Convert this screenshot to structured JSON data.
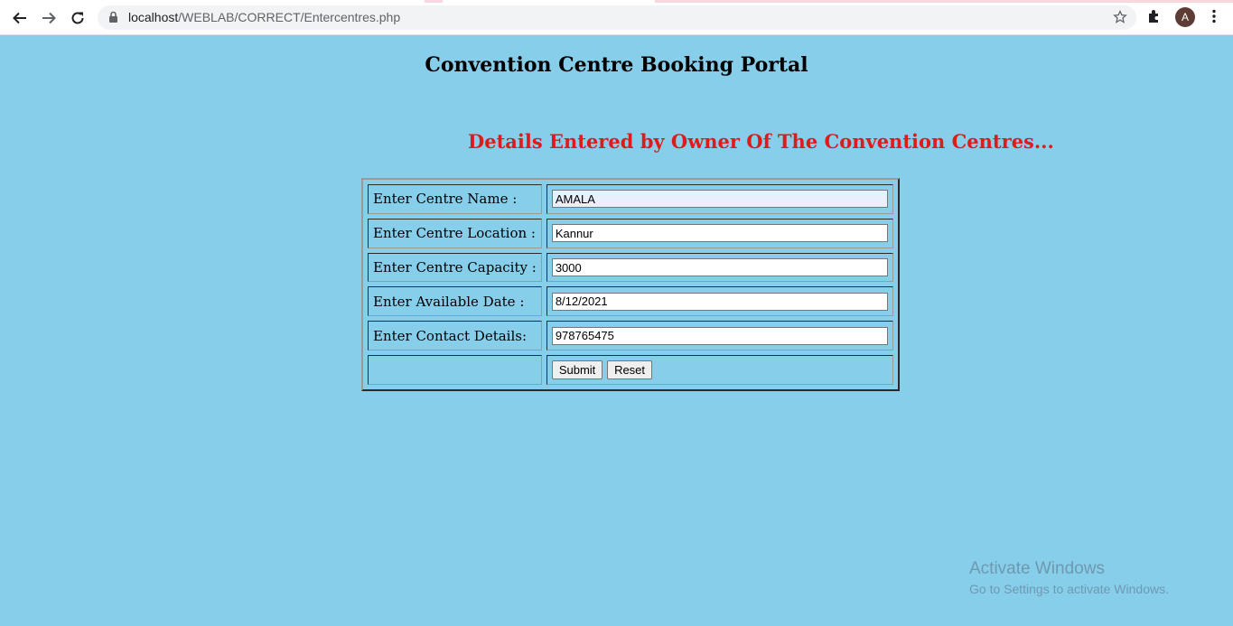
{
  "browser": {
    "url_host": "localhost",
    "url_path": "/WEBLAB/CORRECT/Entercentres.php",
    "avatar_letter": "A",
    "icons": [
      "back-arrow-icon",
      "forward-arrow-icon",
      "reload-icon",
      "lock-icon",
      "star-icon",
      "puzzle-icon",
      "more-vert-icon"
    ]
  },
  "page": {
    "title": "Convention Centre Booking Portal",
    "subtitle": "Details Entered by Owner Of The Convention Centres...",
    "background_color": "#87ceeb",
    "subtitle_color": "#e01a1a"
  },
  "form": {
    "fields": [
      {
        "label": "Enter Centre Name :",
        "value": "AMALA"
      },
      {
        "label": "Enter Centre Location :",
        "value": "Kannur"
      },
      {
        "label": "Enter Centre Capacity :",
        "value": "3000"
      },
      {
        "label": "Enter Available Date :",
        "value": "8/12/2021"
      },
      {
        "label": "Enter Contact Details:",
        "value": "978765475"
      }
    ],
    "submit_label": "Submit",
    "reset_label": "Reset"
  },
  "watermark": {
    "line1": "Activate Windows",
    "line2": "Go to Settings to activate Windows."
  }
}
